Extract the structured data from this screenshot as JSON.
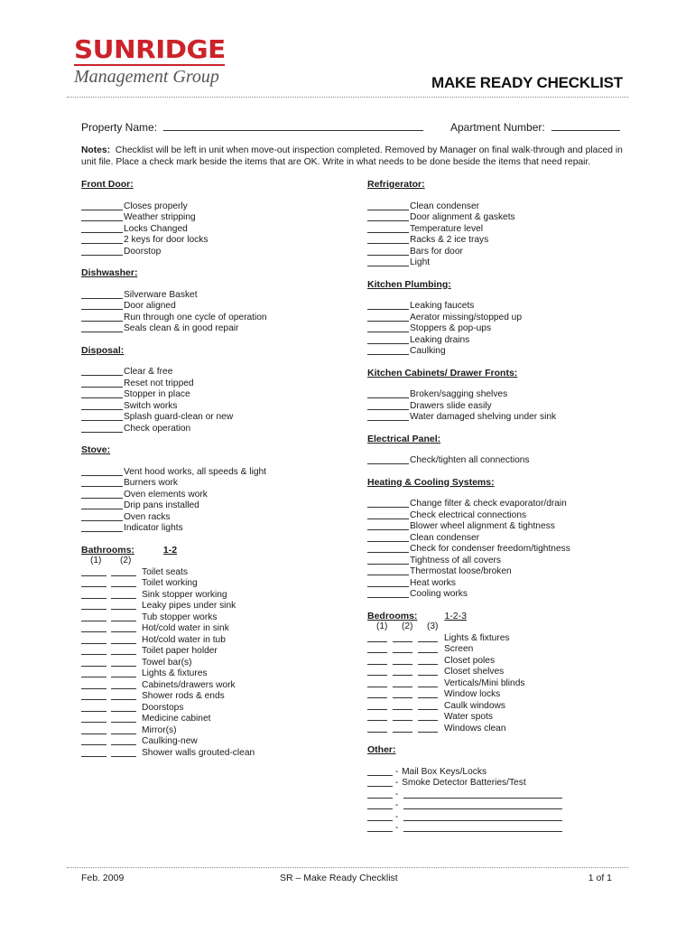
{
  "logo": {
    "company": "SUNRIDGE",
    "subtitle": "Management Group",
    "brand_color": "#cc2229"
  },
  "title": "MAKE READY CHECKLIST",
  "fields": {
    "property_name_label": "Property Name:",
    "property_name_value": "",
    "apartment_number_label": "Apartment Number:",
    "apartment_number_value": ""
  },
  "notes": {
    "label": "Notes:",
    "text": "Checklist will be left in unit when move-out inspection completed.  Removed by Manager on final walk-through and placed in unit file.  Place a check mark beside the items that are OK.  Write in what needs to be done beside the items that need repair."
  },
  "left_column": {
    "front_door": {
      "heading": "Front Door:",
      "items": [
        "Closes properly",
        "Weather stripping",
        "Locks Changed",
        "2 keys for door locks",
        "Doorstop"
      ]
    },
    "dishwasher": {
      "heading": "Dishwasher:",
      "items": [
        "Silverware Basket",
        "Door aligned",
        "Run through one cycle of operation",
        "Seals clean & in good repair"
      ]
    },
    "disposal": {
      "heading": "Disposal:",
      "items": [
        "Clear & free",
        "Reset not tripped",
        "Stopper in place",
        "Switch works",
        "Splash guard-clean or new",
        "Check operation"
      ]
    },
    "stove": {
      "heading": "Stove:",
      "items": [
        "Vent hood works, all speeds & light",
        "Burners work",
        "Oven elements work",
        "Drip pans installed",
        "Oven racks",
        "Indicator lights"
      ]
    },
    "bathrooms": {
      "heading": "Bathrooms:",
      "range": "1-2",
      "columns": [
        "(1)",
        "(2)"
      ],
      "items": [
        "Toilet seats",
        "Toilet working",
        "Sink stopper working",
        "Leaky pipes under sink",
        "Tub stopper works",
        "Hot/cold water in sink",
        "Hot/cold water in tub",
        "Toilet paper holder",
        "Towel bar(s)",
        "Lights & fixtures",
        "Cabinets/drawers work",
        "Shower rods & ends",
        "Doorstops",
        "Medicine cabinet",
        "Mirror(s)",
        "Caulking-new",
        "Shower walls grouted-clean"
      ]
    }
  },
  "right_column": {
    "refrigerator": {
      "heading": "Refrigerator:",
      "items": [
        "Clean condenser",
        "Door alignment & gaskets",
        "Temperature level",
        "Racks & 2 ice trays",
        "Bars for door",
        "Light"
      ]
    },
    "kitchen_plumbing": {
      "heading": "Kitchen Plumbing:",
      "items": [
        "Leaking faucets",
        "Aerator missing/stopped up",
        "Stoppers & pop-ups",
        "Leaking drains",
        "Caulking"
      ]
    },
    "kitchen_cabinets": {
      "heading": "Kitchen Cabinets/ Drawer Fronts:",
      "items": [
        "Broken/sagging shelves",
        "Drawers slide easily",
        "Water damaged shelving under sink"
      ]
    },
    "electrical_panel": {
      "heading": "Electrical Panel:",
      "items": [
        "Check/tighten all connections"
      ]
    },
    "heating_cooling": {
      "heading": "Heating & Cooling Systems:",
      "items": [
        "Change filter & check evaporator/drain",
        "Check electrical connections",
        "Blower wheel alignment & tightness",
        "Clean condenser",
        "Check for condenser freedom/tightness",
        "Tightness of all covers",
        "Thermostat loose/broken",
        "Heat works",
        "Cooling works"
      ]
    },
    "bedrooms": {
      "heading": "Bedrooms:",
      "range": "1-2-3",
      "columns": [
        "(1)",
        "(2)",
        "(3)"
      ],
      "items": [
        "Lights & fixtures",
        "Screen",
        "Closet poles",
        "Closet shelves",
        "Verticals/Mini blinds",
        "Window locks",
        "Caulk windows",
        "Water spots",
        "Windows clean"
      ]
    },
    "other": {
      "heading": "Other:",
      "items": [
        "Mail Box Keys/Locks",
        "Smoke Detector Batteries/Test",
        "",
        "",
        "",
        ""
      ]
    }
  },
  "footer": {
    "date": "Feb. 2009",
    "doc_name": "SR – Make Ready Checklist",
    "page": "1 of 1"
  }
}
